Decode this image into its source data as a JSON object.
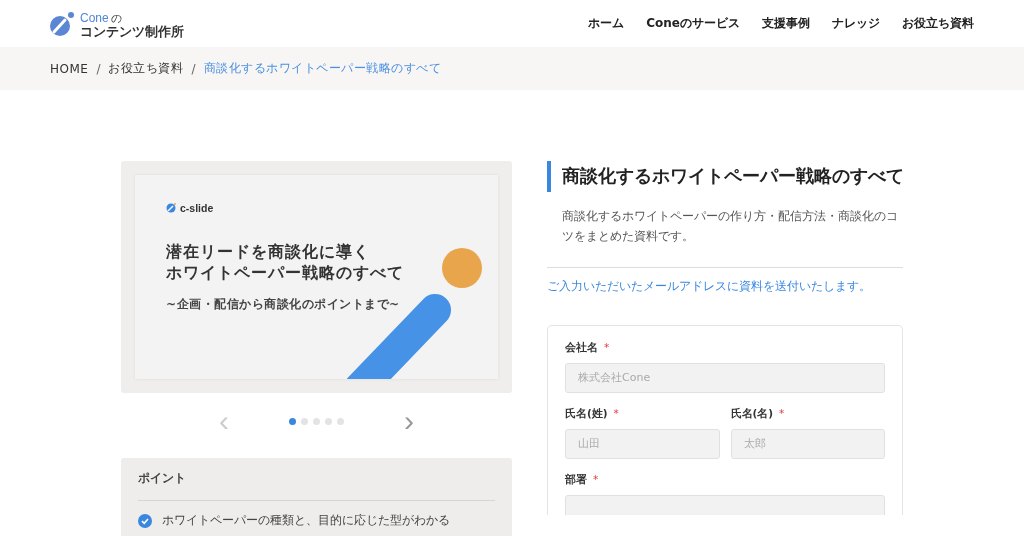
{
  "header": {
    "logo": {
      "brand": "Cone",
      "suffix": "の",
      "name": "コンテンツ制作所"
    },
    "nav": [
      {
        "label": "ホーム"
      },
      {
        "label": "Coneのサービス"
      },
      {
        "label": "支援事例"
      },
      {
        "label": "ナレッジ"
      },
      {
        "label": "お役立ち資料"
      }
    ]
  },
  "breadcrumb": [
    {
      "label": "HOME",
      "current": false
    },
    {
      "label": "お役立ち資料",
      "current": false
    },
    {
      "label": "商談化するホワイトペーパー戦略のすべて",
      "current": true
    }
  ],
  "breadcrumb_separator": "/",
  "carousel": {
    "slide": {
      "brand": "c-slide",
      "title_lines": [
        "潜在リードを商談化に導く",
        "ホワイトペーパー戦略のすべて"
      ],
      "subtitle": "~企画・配信から商談化のポイントまで~"
    },
    "prev": "‹",
    "next": "›",
    "dots": [
      {
        "selected": true
      },
      {
        "selected": false
      },
      {
        "selected": false
      },
      {
        "selected": false
      },
      {
        "selected": false
      }
    ]
  },
  "points": {
    "title": "ポイント",
    "items": [
      {
        "text": "ホワイトペーパーの種類と、目的に応じた型がわかる",
        "checked": true
      }
    ]
  },
  "resource": {
    "title": "商談化するホワイトペーパー戦略のすべて",
    "description": "商談化するホワイトペーパーの作り方・配信方法・商談化のコツをまとめた資料です。",
    "note": "ご入力いただいたメールアドレスに資料を送付いたします。"
  },
  "form": {
    "rows": [
      [
        {
          "label": "会社名",
          "required_mark": "*",
          "placeholder": "株式会社Cone"
        }
      ],
      [
        {
          "label": "氏名(姓)",
          "required_mark": "*",
          "placeholder": "山田"
        },
        {
          "label": "氏名(名)",
          "required_mark": "*",
          "placeholder": "太郎"
        }
      ],
      [
        {
          "label": "部署",
          "required_mark": "*"
        }
      ]
    ]
  }
}
